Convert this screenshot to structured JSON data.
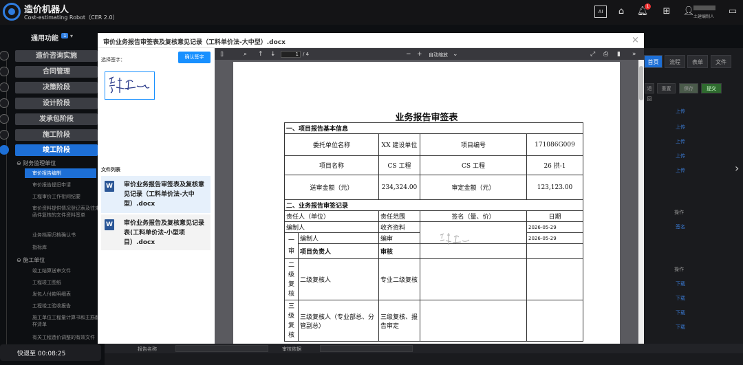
{
  "app": {
    "title": "造价机器人",
    "subtitle": "Cost-estimating Robot（CER 2.0）",
    "user_role": "土建编制人",
    "notification_count": "1"
  },
  "quick": {
    "label": "通用功能",
    "count": "1"
  },
  "stages": [
    "造价咨询实施",
    "合同管理",
    "决策阶段",
    "设计阶段",
    "发承包阶段",
    "施工阶段",
    "竣工阶段"
  ],
  "tree": {
    "group1": "财务监理单位",
    "group1_items": [
      "审价报告编制",
      "审价报告提旧申请",
      "工程审价工作衔间纪要",
      "审价资料提供情况登记表及往来函件复核的文件资料签单",
      "业务档案归档确认书",
      "指标库"
    ],
    "group2": "施工单位",
    "group2_items": [
      "竣工结算送审文件",
      "工程竣工图纸",
      "发包人付款明细表",
      "工程竣工验收报告",
      "施工单位工程量计算书和主筋翻样清单",
      "有关工程造价调整的有效文件"
    ]
  },
  "timer": {
    "label": "快退至",
    "time": "00:08:25"
  },
  "bg": {
    "tabs": [
      "首页",
      "流程",
      "表单",
      "文件"
    ],
    "buttons": [
      "退回",
      "重置",
      "保存",
      "提交"
    ],
    "upload": "上传",
    "op_header": "操作",
    "sign": "签名",
    "download": "下载",
    "bottom_labels": [
      "报告名称",
      "审核依据"
    ]
  },
  "modal": {
    "title": "审价业务报告审签表及复核意见记录（工料单价法-大中型）.docx",
    "select_sig_label": "选择签字：",
    "confirm_btn": "确认签字",
    "file_list_label": "文件列表",
    "files": [
      "审价业务报告审签表及复核意见记录（工料单价法-大中型）.docx",
      "审价业务报告及复核意见记录表(工料单价法-小型项目）.docx"
    ]
  },
  "pdf": {
    "page": "1",
    "total": "/ 4",
    "zoom": "自动缩放"
  },
  "doc": {
    "title": "业务报告审签表",
    "sec1": "一、项目报告基本信息",
    "client_label": "委托单位名称",
    "client_value": "XX 建设单位",
    "proj_no_label": "项目编号",
    "proj_no_value": "171086G009",
    "proj_name_label": "项目名称",
    "proj_name_value": "CS 工程",
    "proj_name_value2": "CS 工程",
    "proj_name_value3": "26 拱-1",
    "submit_label": "送审金额（元）",
    "submit_value": "234,324.00",
    "approved_label": "审定金额（元）",
    "approved_value": "123,123.00",
    "sec2": "二、业务报告审签记录",
    "col_person": "责任人（单位）",
    "col_scope": "责任范围",
    "col_sign": "签名（量、价）",
    "col_date": "日期",
    "r1_person": "编制人",
    "r1_scope": "收齐资料",
    "r1_date": "2026-05-29",
    "r2_side": "一审",
    "r2_person": "编制人",
    "r2_scope": "编审",
    "r2_date": "2026-05-29",
    "r3_person": "项目负责人",
    "r3_scope": "审核",
    "r4_side": "二级复核",
    "r4_person": "二级复核人",
    "r4_scope": "专业二级复核",
    "r5_side": "三级复核",
    "r5_person": "三级复核人（专业部总、分管副总）",
    "r5_scope": "三级复核、报告审定"
  }
}
